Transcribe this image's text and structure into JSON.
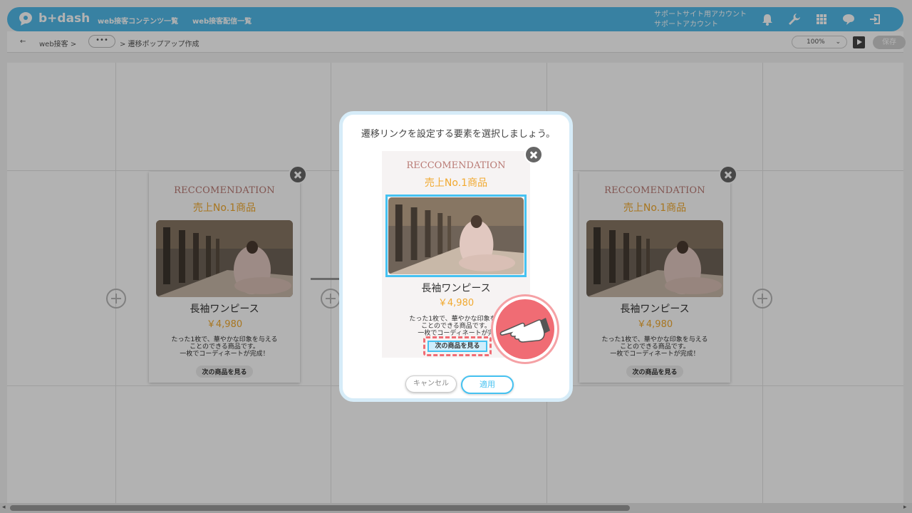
{
  "header": {
    "logo_text": "b+dash",
    "nav": [
      "web接客コンテンツ一覧",
      "web接客配信一覧"
    ],
    "account_line1": "サポートサイト用アカウント",
    "account_line2": "サポートアカウント",
    "icons": [
      "bell-icon",
      "wrench-icon",
      "grid-icon",
      "chat-icon",
      "logout-icon"
    ]
  },
  "subbar": {
    "breadcrumb_root": "web接客 >",
    "breadcrumb_more": "•••",
    "breadcrumb_current": "> 遷移ポップアップ作成",
    "zoom": "100%",
    "save_label": "保存"
  },
  "card": {
    "title": "RECCOMENDATION",
    "subtitle": "売上No.1商品",
    "product_name": "長袖ワンピース",
    "price": "￥4,980",
    "desc1": "たった1枚で、華やかな印象を与える",
    "desc2": "ことのできる商品です。",
    "desc3": "一枚でコーディネートが完成！",
    "next_label": "次の商品を見る"
  },
  "modal": {
    "title": "遷移リンクを設定する要素を選択しましょう。",
    "desc1": "たった1枚で、華やかな印象を与",
    "desc2": "ことのできる商品です。",
    "desc3": "一枚でコーディネートが完",
    "cancel_label": "キャンセル",
    "apply_label": "適用"
  },
  "colors": {
    "accent": "#51b9e8",
    "highlight": "#45c2f1",
    "price": "#f1a92f",
    "title": "#b97a74",
    "pointer": "#f06c74"
  }
}
